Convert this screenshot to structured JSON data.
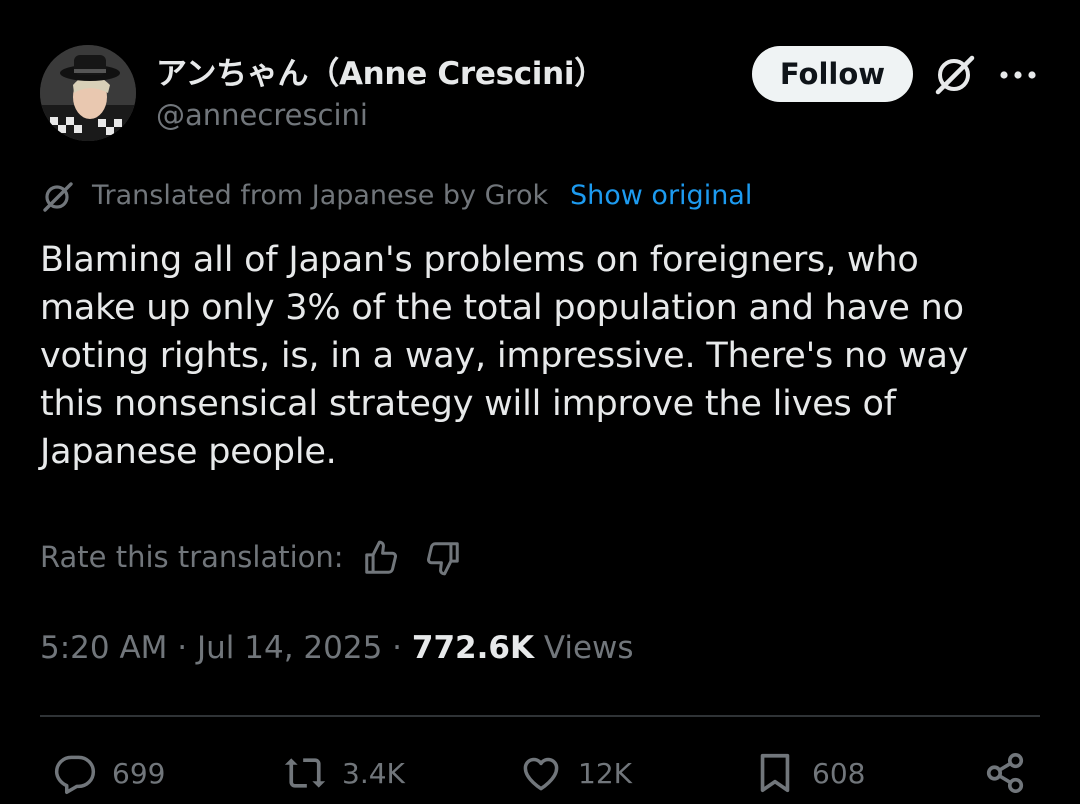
{
  "author": {
    "display_name": "アンちゃん（Anne Crescini）",
    "handle": "@annecrescini",
    "avatar_icon": "avatar-photo"
  },
  "header": {
    "follow_label": "Follow",
    "grok_icon": "grok-icon",
    "more_icon": "more-icon"
  },
  "translation": {
    "notice": "Translated from Japanese by Grok",
    "show_original": "Show original",
    "rate_label": "Rate this translation:"
  },
  "tweet": {
    "text": "Blaming all of Japan's problems on foreigners, who\nmake up only 3% of the total population and have no\nvoting rights, is, in a way, impressive. There's no way\nthis nonsensical strategy will improve the lives of\nJapanese people."
  },
  "meta": {
    "time": "5:20 AM",
    "date": "Jul 14, 2025",
    "views_count": "772.6K",
    "views_label": "Views"
  },
  "actions": {
    "replies": "699",
    "reposts": "3.4K",
    "likes": "12K",
    "bookmarks": "608"
  },
  "colors": {
    "background": "#000000",
    "primary_text": "#e7e9ea",
    "secondary_text": "#71767b",
    "link": "#1d9bf0",
    "follow_bg": "#eff3f4"
  }
}
